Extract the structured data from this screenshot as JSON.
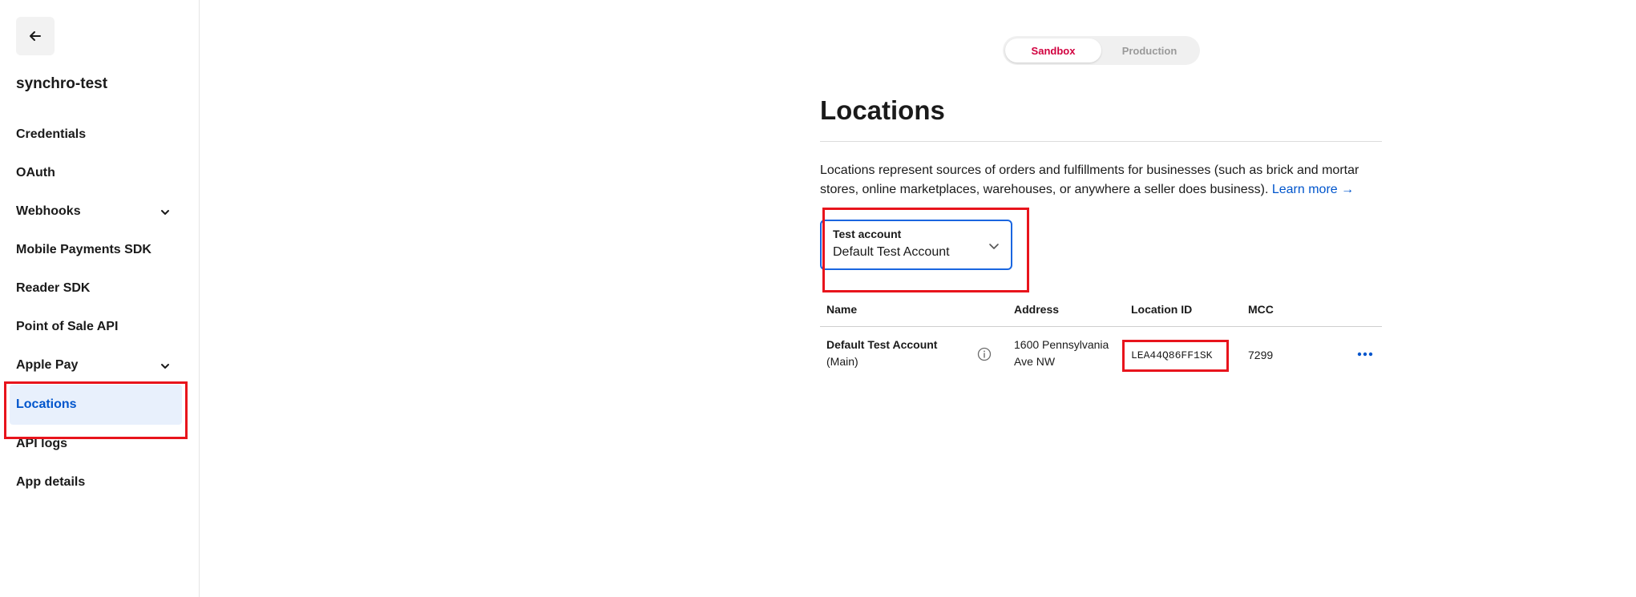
{
  "app": {
    "name": "synchro-test"
  },
  "sidebar": {
    "items": [
      {
        "label": "Credentials"
      },
      {
        "label": "OAuth"
      },
      {
        "label": "Webhooks",
        "expandable": true
      },
      {
        "label": "Mobile Payments SDK"
      },
      {
        "label": "Reader SDK"
      },
      {
        "label": "Point of Sale API"
      },
      {
        "label": "Apple Pay",
        "expandable": true
      },
      {
        "label": "Locations",
        "active": true
      },
      {
        "label": "API logs"
      },
      {
        "label": "App details"
      }
    ]
  },
  "environment": {
    "options": [
      "Sandbox",
      "Production"
    ],
    "selected": "Sandbox"
  },
  "main": {
    "title": "Locations",
    "description": "Locations represent sources of orders and fulfillments for businesses (such as brick and mortar stores, online marketplaces, warehouses, or anywhere a seller does business).",
    "learn_more": "Learn more →",
    "account_select": {
      "label": "Test account",
      "value": "Default Test Account"
    },
    "table": {
      "columns": [
        "Name",
        "Address",
        "Location ID",
        "MCC"
      ],
      "rows": [
        {
          "name": "Default Test Account",
          "name_suffix": "(Main)",
          "address_line1": "1600 Pennsylvania",
          "address_line2": "Ave NW",
          "location_id": "LEA44Q86FF1SK",
          "mcc": "7299"
        }
      ]
    }
  },
  "colors": {
    "accent": "#0055cc",
    "sandbox": "#d1003f",
    "annotation": "#e8141c"
  },
  "icons": {
    "back": "arrow-left-icon",
    "expand": "chevron-down-icon",
    "info": "info-circle-icon",
    "more": "more-horizontal-icon"
  }
}
